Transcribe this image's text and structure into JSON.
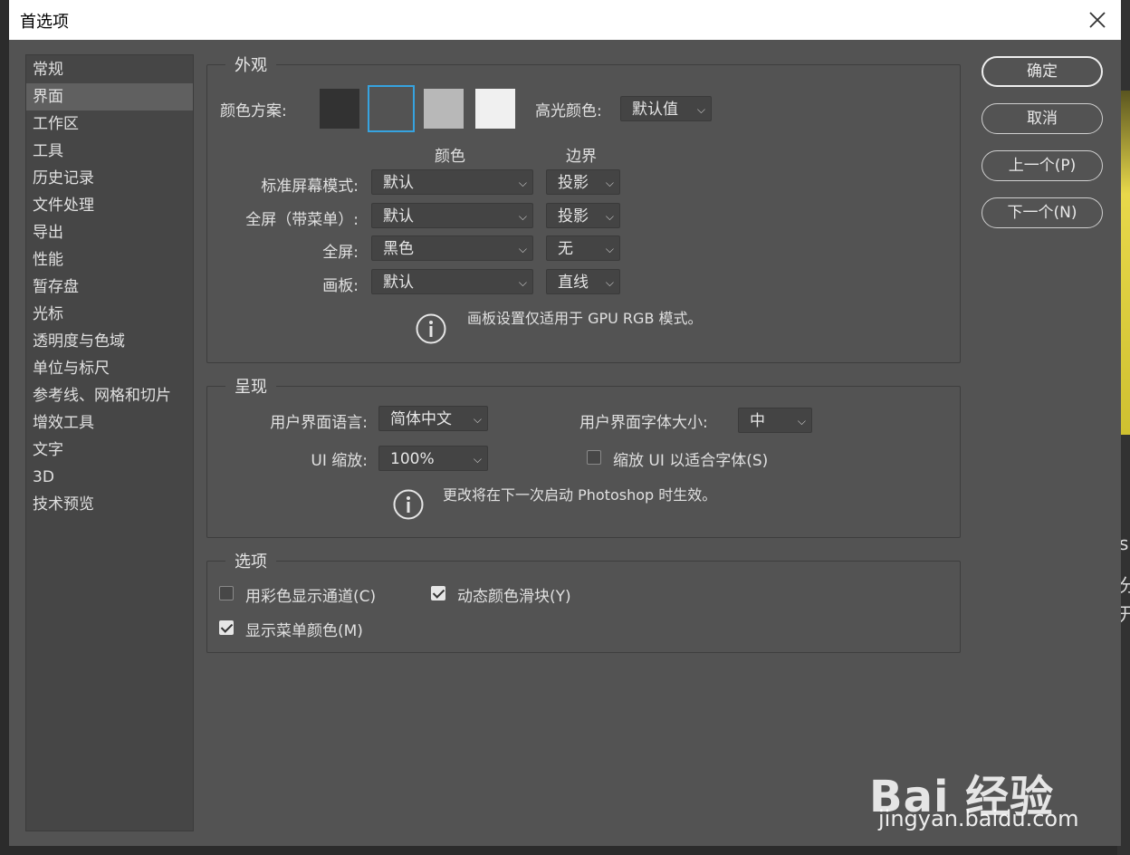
{
  "window": {
    "title": "首选项"
  },
  "background": {
    "text1": "s",
    "text2": "分",
    "text3": "开"
  },
  "sidebar": {
    "items": [
      {
        "label": "常规"
      },
      {
        "label": "界面"
      },
      {
        "label": "工作区"
      },
      {
        "label": "工具"
      },
      {
        "label": "历史记录"
      },
      {
        "label": "文件处理"
      },
      {
        "label": "导出"
      },
      {
        "label": "性能"
      },
      {
        "label": "暂存盘"
      },
      {
        "label": "光标"
      },
      {
        "label": "透明度与色域"
      },
      {
        "label": "单位与标尺"
      },
      {
        "label": "参考线、网格和切片"
      },
      {
        "label": "增效工具"
      },
      {
        "label": "文字"
      },
      {
        "label": "3D"
      },
      {
        "label": "技术预览"
      }
    ],
    "active_index": 1
  },
  "appearance": {
    "group_label": "外观",
    "color_scheme_label": "颜色方案:",
    "swatches": [
      "#323232",
      "#535353",
      "#b8b8b8",
      "#f0f0f0"
    ],
    "selected_swatch": 1,
    "highlight_label": "高光颜色:",
    "highlight_value": "默认值",
    "col_color": "颜色",
    "col_border": "边界",
    "rows": [
      {
        "label": "标准屏幕模式:",
        "color": "默认",
        "border": "投影"
      },
      {
        "label": "全屏（带菜单）:",
        "color": "默认",
        "border": "投影"
      },
      {
        "label": "全屏:",
        "color": "黑色",
        "border": "无"
      },
      {
        "label": "画板:",
        "color": "默认",
        "border": "直线"
      }
    ],
    "note": "画板设置仅适用于 GPU RGB 模式。"
  },
  "presentation": {
    "group_label": "呈现",
    "ui_lang_label": "用户界面语言:",
    "ui_lang_value": "简体中文",
    "ui_font_label": "用户界面字体大小:",
    "ui_font_value": "中",
    "ui_scale_label": "UI 缩放:",
    "ui_scale_value": "100%",
    "scale_fit_label": "缩放 UI 以适合字体(S)",
    "scale_fit_checked": false,
    "note": "更改将在下一次启动 Photoshop 时生效。"
  },
  "options": {
    "group_label": "选项",
    "color_channels_label": "用彩色显示通道(C)",
    "color_channels_checked": false,
    "dynamic_sliders_label": "动态颜色滑块(Y)",
    "dynamic_sliders_checked": true,
    "menu_colors_label": "显示菜单颜色(M)",
    "menu_colors_checked": true
  },
  "buttons": {
    "ok": "确定",
    "cancel": "取消",
    "prev": "上一个(P)",
    "next": "下一个(N)"
  },
  "watermark": {
    "logo": "Bai 经验",
    "url": "jingyan.baidu.com"
  }
}
